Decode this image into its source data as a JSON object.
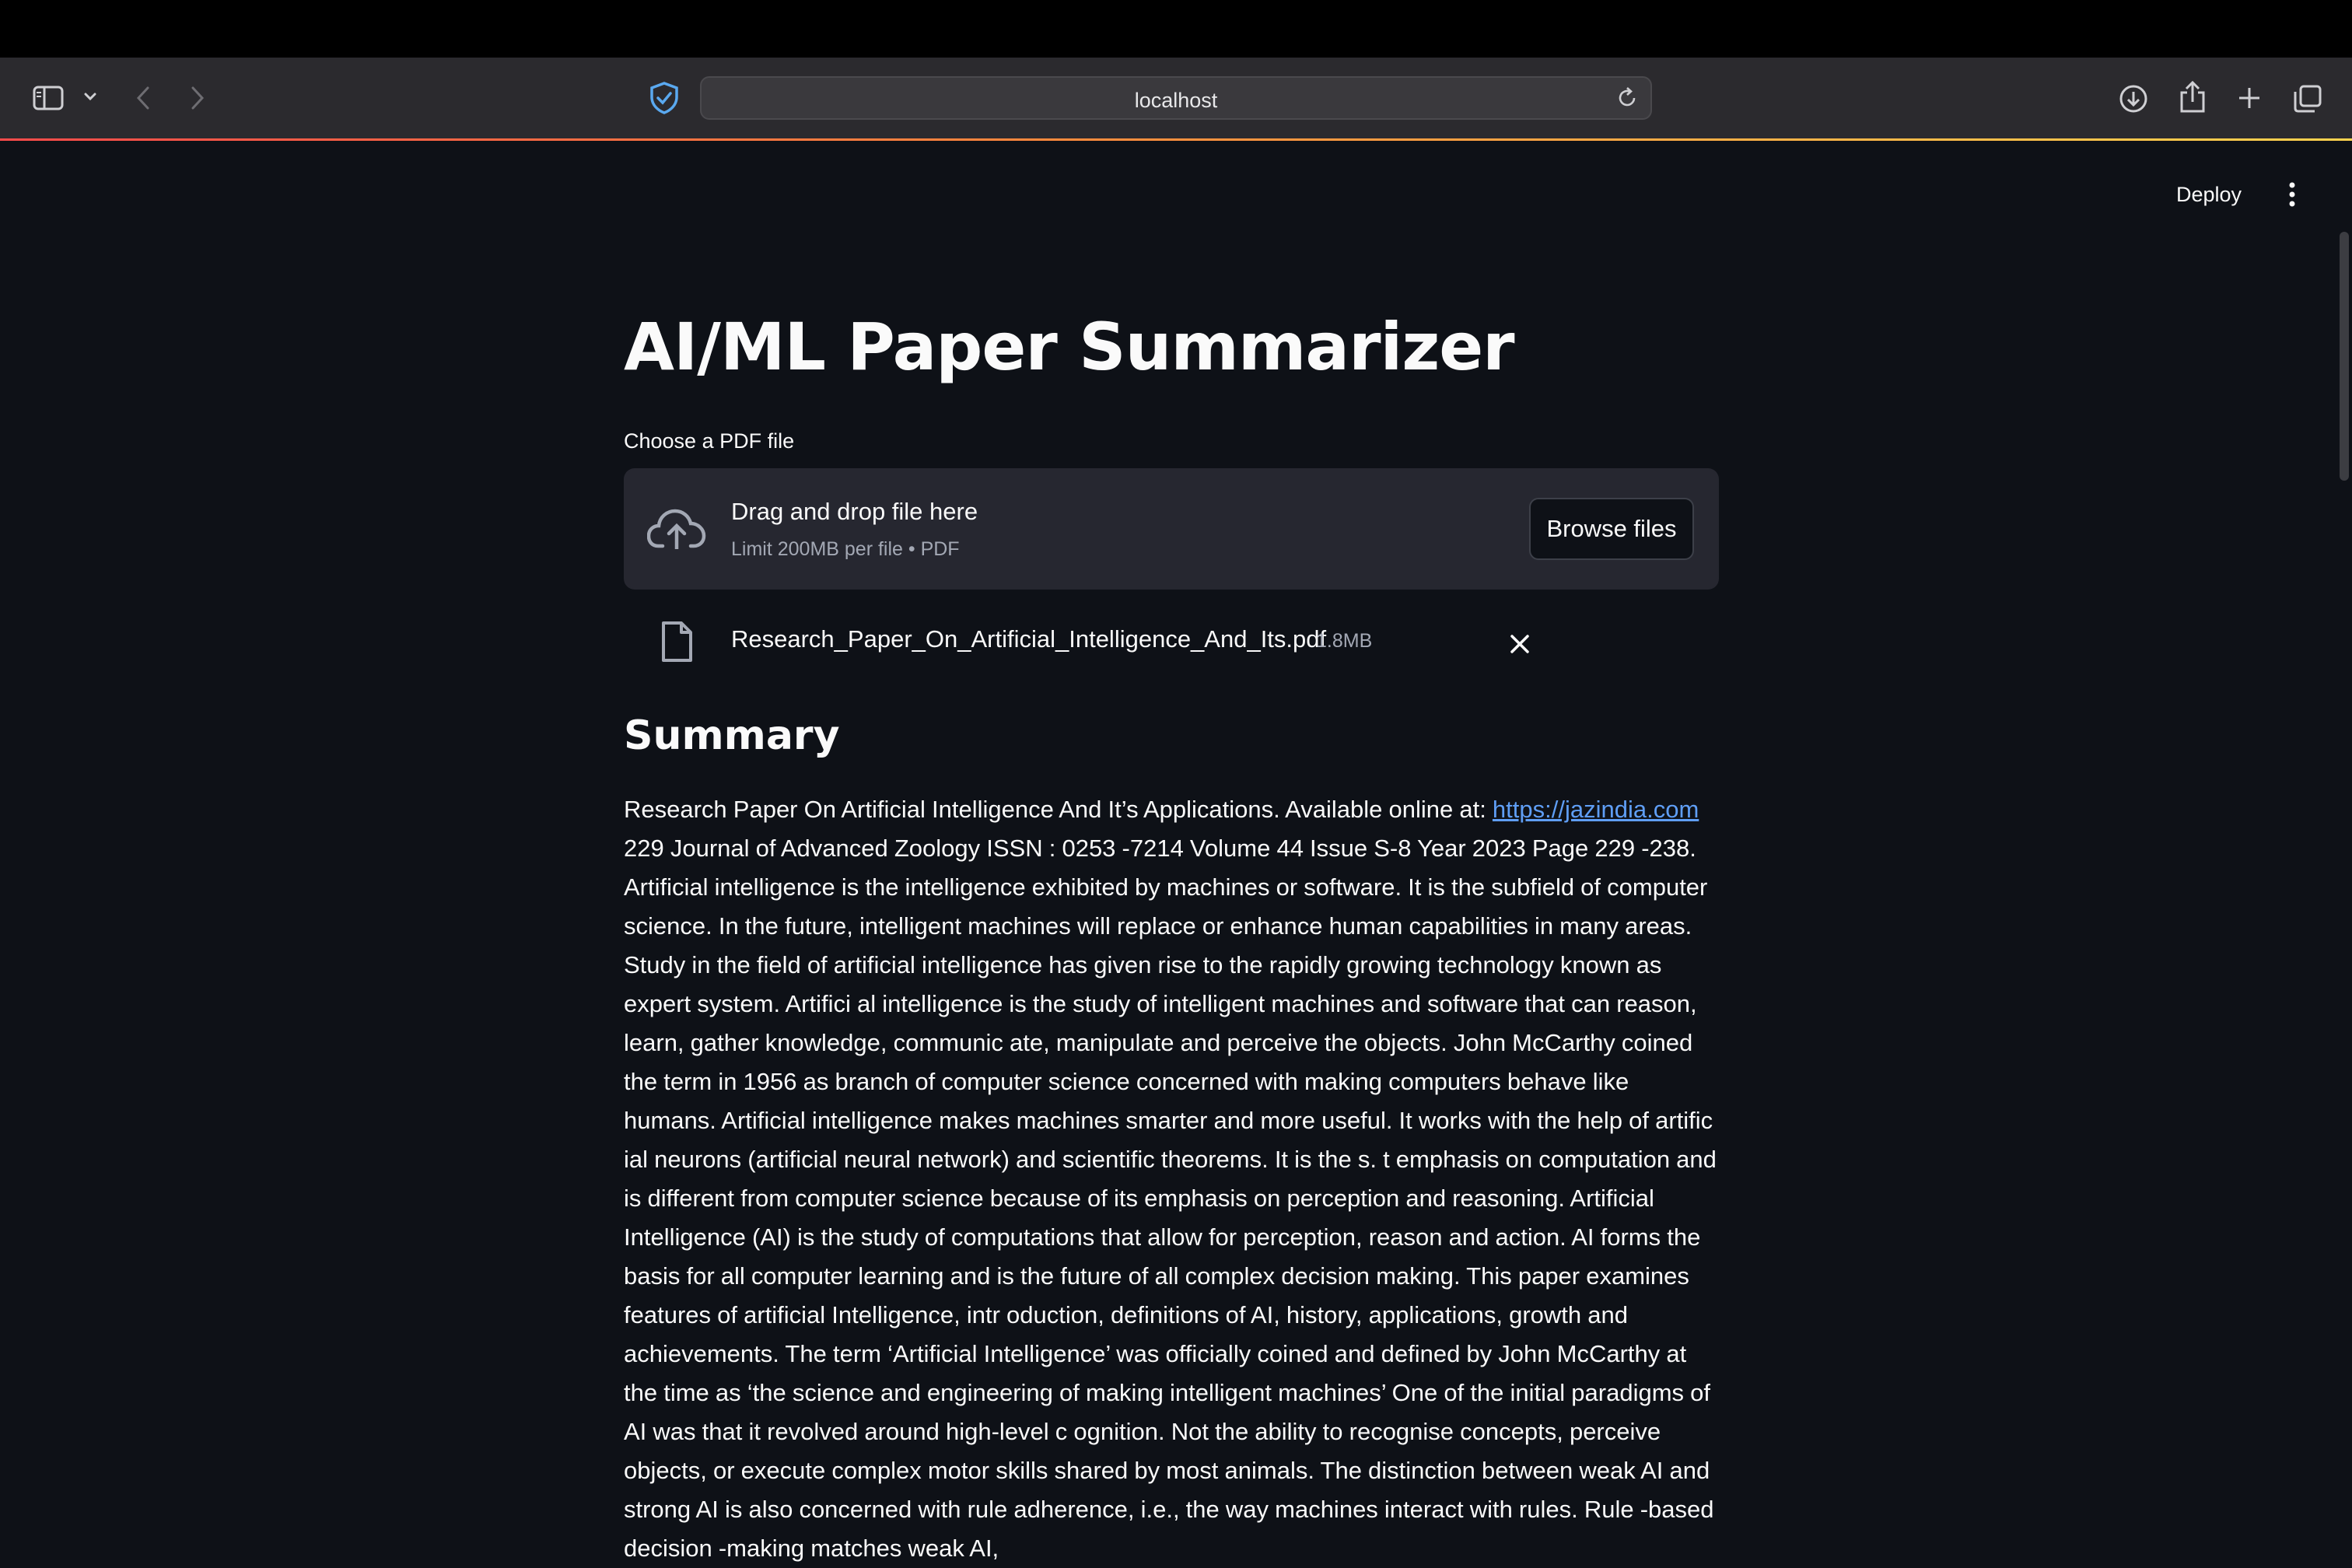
{
  "browser": {
    "url": "localhost"
  },
  "app": {
    "deploy_label": "Deploy",
    "title": "AI/ML Paper Summarizer",
    "uploader": {
      "label": "Choose a PDF file",
      "drop_text": "Drag and drop file here",
      "limit_text": "Limit 200MB per file • PDF",
      "browse_label": "Browse files"
    },
    "file": {
      "name": "Research_Paper_On_Artificial_Intelligence_And_Its.pdf",
      "size": "1.8MB"
    },
    "summary": {
      "heading": "Summary",
      "text_before_link": "Research Paper On Artificial Intelligence And It’s Applications. Available online at: ",
      "link_text": "https://jazindia.com",
      "text_after_link": " 229 Journal of Advanced Zoology ISSN : 0253 -7214 Volume 44 Issue S-8 Year 2023 Page 229 -238. Artificial intelligence is the intelligence exhibited by machines or software. It is the subfield of computer science. In the future, intelligent machines will replace or enhance human capabilities in many areas. Study in the field of artificial intelligence has given rise to the rapidly growing technology known as expert system. Artifici al intelligence is the study of intelligent machines and software that can reason, learn, gather knowledge, communic ate, manipulate and perceive the objects. John McCarthy coined the term in 1956 as branch of computer science concerned with making computers behave like humans. Artificial intelligence makes machines smarter and more useful. It works with the help of artific ial neurons (artificial neural network) and scientific theorems. It is the s. t emphasis on computation and is different from computer science because of its emphasis on perception and reasoning. Artificial Intelligence (AI) is the study of computations that allow for perception, reason and action. AI forms the basis for all computer learning and is the future of all complex decision making. This paper examines features of artificial Intelligence, intr oduction, definitions of AI, history, applications, growth and achievements. The term ‘Artificial Intelligence’ was officially coined and defined by John McCarthy at the time as ‘the science and engineering of making intelligent machines’ One of the initial paradigms of AI was that it revolved around high-level c ognition. Not the ability to recognise concepts, perceive objects, or execute complex motor skills shared by most animals. The distinction between weak AI and strong AI is also concerned with rule adherence, i.e., the way machines interact with rules. Rule -based decision -making matches weak AI,"
    }
  },
  "colors": {
    "background": "#0e1117",
    "toolbar": "#2b2a2e",
    "dropzone": "#262730",
    "link": "#5f9ef5"
  }
}
